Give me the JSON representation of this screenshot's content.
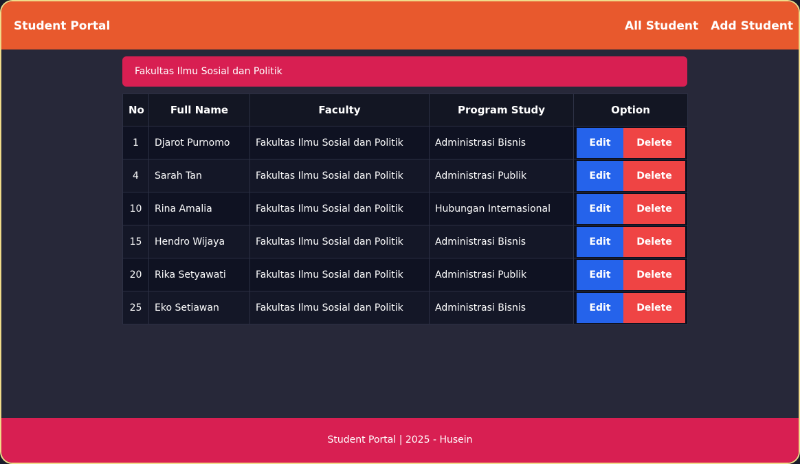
{
  "navbar": {
    "brand": "Student Portal",
    "links": [
      "All Student",
      "Add Student"
    ]
  },
  "alert": {
    "text": "Fakultas Ilmu Sosial dan Politik"
  },
  "table": {
    "headers": [
      "No",
      "Full Name",
      "Faculty",
      "Program Study",
      "Option"
    ],
    "rows": [
      {
        "no": "1",
        "name": "Djarot Purnomo",
        "faculty": "Fakultas Ilmu Sosial dan Politik",
        "program": "Administrasi Bisnis"
      },
      {
        "no": "4",
        "name": "Sarah Tan",
        "faculty": "Fakultas Ilmu Sosial dan Politik",
        "program": "Administrasi Publik"
      },
      {
        "no": "10",
        "name": "Rina Amalia",
        "faculty": "Fakultas Ilmu Sosial dan Politik",
        "program": "Hubungan Internasional"
      },
      {
        "no": "15",
        "name": "Hendro Wijaya",
        "faculty": "Fakultas Ilmu Sosial dan Politik",
        "program": "Administrasi Bisnis"
      },
      {
        "no": "20",
        "name": "Rika Setyawati",
        "faculty": "Fakultas Ilmu Sosial dan Politik",
        "program": "Administrasi Publik"
      },
      {
        "no": "25",
        "name": "Eko Setiawan",
        "faculty": "Fakultas Ilmu Sosial dan Politik",
        "program": "Administrasi Bisnis"
      }
    ],
    "edit_label": "Edit",
    "delete_label": "Delete"
  },
  "footer": {
    "text": "Student Portal | 2025 - Husein"
  },
  "colors": {
    "navbar": "#e8592d",
    "accent": "#d81f52",
    "edit": "#2563eb",
    "delete": "#ef4444",
    "background": "#272839",
    "frame_border": "#f0dc8a"
  }
}
